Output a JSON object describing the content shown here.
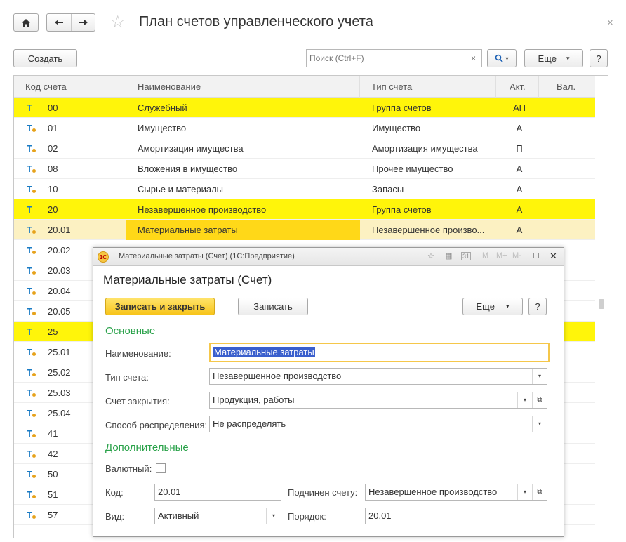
{
  "window": {
    "title": "План счетов управленческого учета",
    "home_icon": "home-icon",
    "back_icon": "arrow-left-icon",
    "forward_icon": "arrow-right-icon",
    "favorite_icon": "star-icon",
    "close_glyph": "×"
  },
  "toolbar": {
    "create_label": "Создать",
    "search_placeholder": "Поиск (Ctrl+F)",
    "clear_glyph": "×",
    "search_glyph": "🔍▾",
    "more_label": "Еще",
    "more_arrow": "▾",
    "help_label": "?"
  },
  "table": {
    "columns": [
      "Код счета",
      "Наименование",
      "Тип счета",
      "Акт.",
      "Вал."
    ],
    "rows": [
      {
        "icon": "T",
        "code": "00",
        "name": "Служебный",
        "type": "Группа счетов",
        "akt": "АП",
        "style": "yellow"
      },
      {
        "icon": "T",
        "code": "01",
        "name": "Имущество",
        "type": "Имущество",
        "akt": "А",
        "style": ""
      },
      {
        "icon": "T",
        "code": "02",
        "name": "Амортизация имущества",
        "type": "Амортизация имущества",
        "akt": "П",
        "style": ""
      },
      {
        "icon": "T",
        "code": "08",
        "name": "Вложения в имущество",
        "type": "Прочее имущество",
        "akt": "А",
        "style": ""
      },
      {
        "icon": "T",
        "code": "10",
        "name": "Сырье и материалы",
        "type": "Запасы",
        "akt": "А",
        "style": ""
      },
      {
        "icon": "T",
        "code": "20",
        "name": "Незавершенное производство",
        "type": "Группа счетов",
        "akt": "А",
        "style": "yellow"
      },
      {
        "icon": "T",
        "code": "20.01",
        "name": "Материальные затраты",
        "type": "Незавершенное произво...",
        "akt": "А",
        "style": "cur"
      },
      {
        "icon": "T",
        "code": "20.02",
        "name": "",
        "type": "",
        "akt": "",
        "style": ""
      },
      {
        "icon": "T",
        "code": "20.03",
        "name": "",
        "type": "",
        "akt": "",
        "style": ""
      },
      {
        "icon": "T",
        "code": "20.04",
        "name": "",
        "type": "",
        "akt": "",
        "style": ""
      },
      {
        "icon": "T",
        "code": "20.05",
        "name": "",
        "type": "",
        "akt": "",
        "style": ""
      },
      {
        "icon": "T",
        "code": "25",
        "name": "",
        "type": "",
        "akt": "",
        "style": "yellow"
      },
      {
        "icon": "T",
        "code": "25.01",
        "name": "",
        "type": "",
        "akt": "",
        "style": ""
      },
      {
        "icon": "T",
        "code": "25.02",
        "name": "",
        "type": "",
        "akt": "",
        "style": ""
      },
      {
        "icon": "T",
        "code": "25.03",
        "name": "",
        "type": "",
        "akt": "",
        "style": ""
      },
      {
        "icon": "T",
        "code": "25.04",
        "name": "",
        "type": "",
        "akt": "",
        "style": ""
      },
      {
        "icon": "T",
        "code": "41",
        "name": "",
        "type": "",
        "akt": "",
        "style": ""
      },
      {
        "icon": "T",
        "code": "42",
        "name": "",
        "type": "",
        "akt": "",
        "style": ""
      },
      {
        "icon": "T",
        "code": "50",
        "name": "",
        "type": "",
        "akt": "",
        "style": ""
      },
      {
        "icon": "T",
        "code": "51",
        "name": "",
        "type": "",
        "akt": "",
        "style": ""
      },
      {
        "icon": "T",
        "code": "57",
        "name": "",
        "type": "",
        "akt": "",
        "style": ""
      }
    ]
  },
  "dialog": {
    "window_title": "Материальные затраты (Счет)  (1С:Предприятие)",
    "title": "Материальные затраты (Счет)",
    "save_close_label": "Записать и закрыть",
    "save_label": "Записать",
    "more_label": "Еще",
    "more_arrow": "▾",
    "help_label": "?",
    "header_icons": [
      "☆",
      "▦",
      "31",
      "M",
      "M+",
      "M-",
      "□",
      "✕"
    ],
    "section_main": "Основные",
    "section_extra": "Дополнительные",
    "name_label": "Наименование:",
    "name_value": "Материальные затраты",
    "type_label": "Тип счета:",
    "type_value": "Незавершенное производство",
    "closing_label": "Счет закрытия:",
    "closing_value": "Продукция, работы",
    "distribution_label": "Способ распределения:",
    "distribution_value": "Не распределять",
    "currency_label": "Валютный:",
    "code_label": "Код:",
    "code_value": "20.01",
    "parent_label": "Подчинен счету:",
    "parent_value": "Незавершенное производство",
    "kind_label": "Вид:",
    "kind_value": "Активный",
    "order_label": "Порядок:",
    "order_value": "20.01",
    "dropdown_glyph": "▾",
    "open_glyph": "⧉"
  }
}
